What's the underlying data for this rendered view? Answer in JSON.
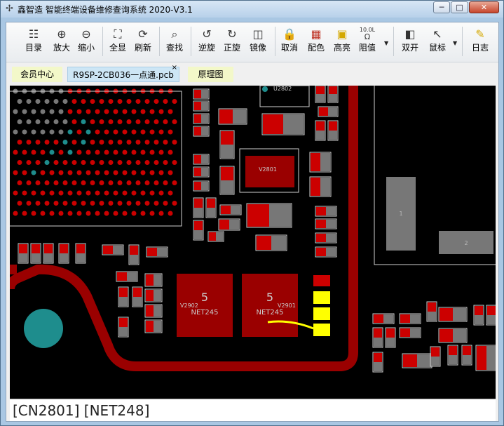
{
  "window": {
    "title": "鑫智造 智能终端设备维修查询系统 2020-V3.1",
    "minimize_glyph": "─",
    "maximize_glyph": "□",
    "close_glyph": "✕"
  },
  "toolbar": {
    "items": [
      {
        "id": "catalog",
        "label": "目录",
        "icon": "catalog-icon",
        "glyph": "☷"
      },
      {
        "id": "zoom-in",
        "label": "放大",
        "icon": "zoom-in-icon",
        "glyph": "⊕"
      },
      {
        "id": "zoom-out",
        "label": "缩小",
        "icon": "zoom-out-icon",
        "glyph": "⊖"
      },
      {
        "id": "full-view",
        "label": "全显",
        "icon": "full-view-icon",
        "glyph": "⛶"
      },
      {
        "id": "refresh",
        "label": "刷新",
        "icon": "refresh-icon",
        "glyph": "⟳"
      },
      {
        "id": "search",
        "label": "查找",
        "icon": "search-icon",
        "glyph": "⌕"
      },
      {
        "id": "rotate-ccw",
        "label": "逆旋",
        "icon": "rotate-ccw-icon",
        "glyph": "↺"
      },
      {
        "id": "rotate-cw",
        "label": "正旋",
        "icon": "rotate-cw-icon",
        "glyph": "↻"
      },
      {
        "id": "mirror",
        "label": "镜像",
        "icon": "mirror-icon",
        "glyph": "◫"
      },
      {
        "id": "cancel",
        "label": "取消",
        "icon": "lock-icon",
        "glyph": "🔒"
      },
      {
        "id": "color",
        "label": "配色",
        "icon": "color-grid-icon",
        "glyph": "▦"
      },
      {
        "id": "highlight",
        "label": "高亮",
        "icon": "highlight-icon",
        "glyph": "▣"
      },
      {
        "id": "resistance",
        "label": "阻值",
        "icon": "resistance-icon",
        "glyph": "Ω"
      },
      {
        "id": "dual-view",
        "label": "双开",
        "icon": "dual-view-icon",
        "glyph": "◧"
      },
      {
        "id": "mouse",
        "label": "鼠标",
        "icon": "mouse-cursor-icon",
        "glyph": "↖"
      },
      {
        "id": "log",
        "label": "日志",
        "icon": "log-icon",
        "glyph": "✎"
      }
    ],
    "resistance_badge": "10.0L"
  },
  "tabs": [
    {
      "label": "会员中心"
    },
    {
      "label": "R9SP-2CB036一点通.pcb",
      "close": "×"
    },
    {
      "label": "原理图"
    }
  ],
  "board": {
    "labels": {
      "u2802": "U2802",
      "v2801": "V2801",
      "v2902": "V2902",
      "v2901": "V2901",
      "net1": "NET245",
      "net2": "NET245",
      "five1": "5",
      "five2": "5",
      "pad1": "1",
      "pad2": "2"
    },
    "colors": {
      "trace": "#9a0000",
      "pad": "#cc0000",
      "silk": "#d0d0d0",
      "highlight": "#ffff00",
      "via_teal": "#1e8d8d",
      "grey": "#777777"
    }
  },
  "status": {
    "text": "[CN2801] [NET248]"
  }
}
